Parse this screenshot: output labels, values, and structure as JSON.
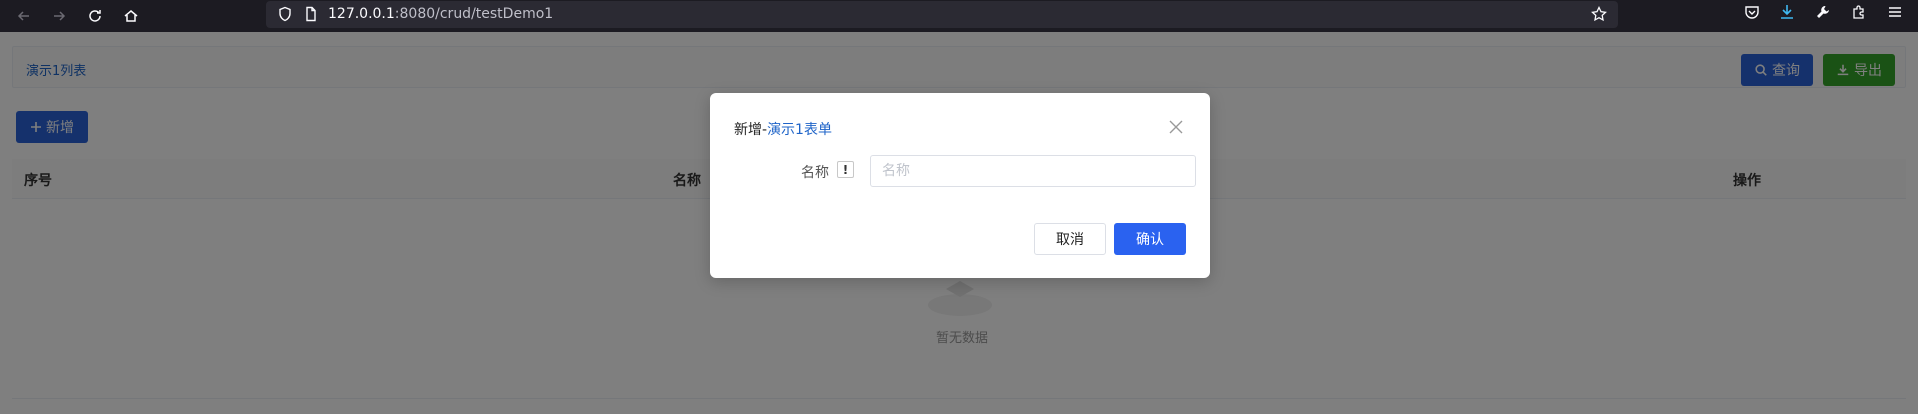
{
  "browser": {
    "url_host": "127.0.0.1",
    "url_rest": ":8080/crud/testDemo1"
  },
  "page": {
    "breadcrumb": "演示1列表",
    "query_label": "查询",
    "export_label": "导出",
    "add_label": "新增",
    "columns": [
      "序号",
      "名称",
      "操作"
    ],
    "empty_text": "暂无数据"
  },
  "dialog": {
    "title_prefix": "新增-",
    "title_accent": "演示1表单",
    "field_label": "名称",
    "help_glyph": "!",
    "field_placeholder": "名称",
    "field_value": "",
    "cancel_label": "取消",
    "ok_label": "确认"
  },
  "colors": {
    "primary": "#2a62f0",
    "accent_text": "#1f64c8",
    "export_green": "#35a52a",
    "browser_chrome": "#1c1b22"
  }
}
